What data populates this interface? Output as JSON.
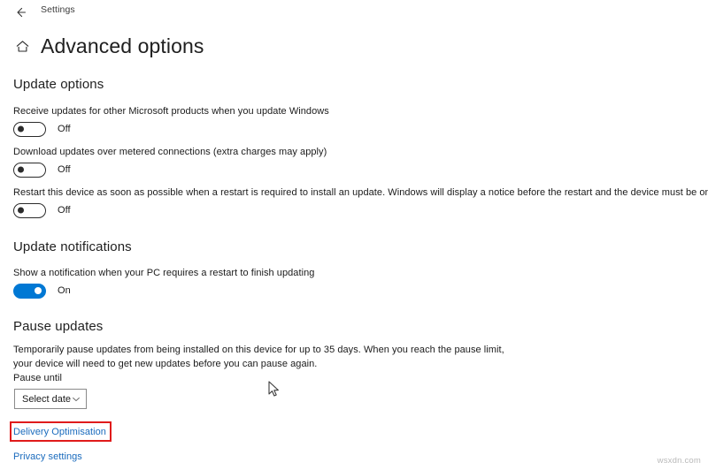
{
  "titlebar": {
    "back_icon": "back-arrow-icon",
    "app_title": "Settings"
  },
  "header": {
    "home_icon": "home-icon",
    "title": "Advanced options"
  },
  "sections": {
    "update_options": {
      "heading": "Update options",
      "items": [
        {
          "description": "Receive updates for other Microsoft products when you update Windows",
          "state_label": "Off",
          "state": "off"
        },
        {
          "description": "Download updates over metered connections (extra charges may apply)",
          "state_label": "Off",
          "state": "off"
        },
        {
          "description": "Restart this device as soon as possible when a restart is required to install an update. Windows will display a notice before the restart and the device must be on and plugged in.",
          "state_label": "Off",
          "state": "off"
        }
      ]
    },
    "update_notifications": {
      "heading": "Update notifications",
      "items": [
        {
          "description": "Show a notification when your PC requires a restart to finish updating",
          "state_label": "On",
          "state": "on"
        }
      ]
    },
    "pause_updates": {
      "heading": "Pause updates",
      "description": "Temporarily pause updates from being installed on this device for up to 35 days. When you reach the pause limit, your device will need to get new updates before you can pause again.",
      "field_label": "Pause until",
      "dropdown_value": "Select date",
      "dropdown_icon": "chevron-down-icon"
    }
  },
  "links": {
    "delivery_optimisation": "Delivery Optimisation",
    "privacy_settings": "Privacy settings"
  },
  "colors": {
    "accent": "#0078d4",
    "link": "#1a6bbd",
    "highlight": "#e01b1b"
  },
  "watermark": "wsxdn.com"
}
